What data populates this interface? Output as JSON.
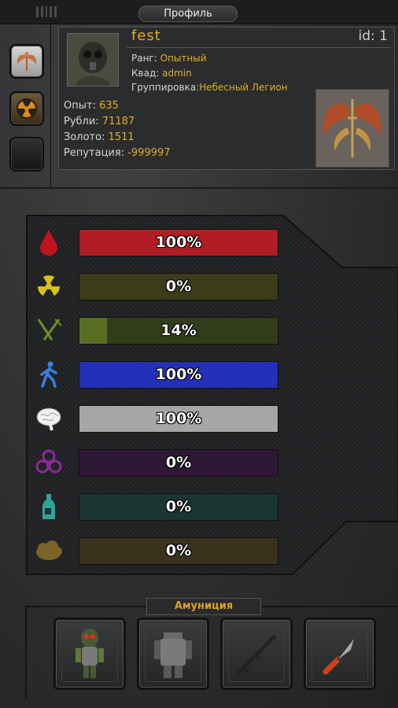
{
  "header": {
    "title": "Профиль"
  },
  "profile": {
    "name": "fest",
    "id_label": "id: 1",
    "rank_label": "Ранг:",
    "rank_value": "Опытный",
    "squad_label": "Квад:",
    "squad_value": "admin",
    "faction_label": "Группировка:",
    "faction_value": "Небесный Легион",
    "exp_label": "Опыт:",
    "exp_value": "635",
    "rubles_label": "Рубли:",
    "rubles_value": "71187",
    "gold_label": "Золото:",
    "gold_value": "1511",
    "rep_label": "Репутация:",
    "rep_value": "-999997"
  },
  "stats": [
    {
      "icon": "blood-drop-icon",
      "label": "100%",
      "percent": 100,
      "color": "#b01d22",
      "track": "#5a1a1a"
    },
    {
      "icon": "radiation-icon",
      "label": "0%",
      "percent": 0,
      "color": "#8a8a1a",
      "track": "#3c3c18"
    },
    {
      "icon": "fork-knife-icon",
      "label": "14%",
      "percent": 14,
      "color": "#5a6e22",
      "track": "#333d1c"
    },
    {
      "icon": "walking-man-icon",
      "label": "100%",
      "percent": 100,
      "color": "#2330b8",
      "track": "#1a1f5a"
    },
    {
      "icon": "brain-icon",
      "label": "100%",
      "percent": 100,
      "color": "#a6a6a6",
      "track": "#555555"
    },
    {
      "icon": "biohazard-icon",
      "label": "0%",
      "percent": 0,
      "color": "#5a1f6a",
      "track": "#2e1836"
    },
    {
      "icon": "bottle-icon",
      "label": "0%",
      "percent": 0,
      "color": "#1f5a54",
      "track": "#1a3532"
    },
    {
      "icon": "cloud-icon",
      "label": "0%",
      "percent": 0,
      "color": "#6a5a26",
      "track": "#3a321c"
    }
  ],
  "ammo": {
    "label": "Амуниция"
  },
  "slots": [
    "hazmat-suit-icon",
    "body-armor-icon",
    "rifle-icon",
    "knife-icon"
  ],
  "colors": {
    "accent": "#e0b020",
    "panel": "#2b2c2d"
  }
}
